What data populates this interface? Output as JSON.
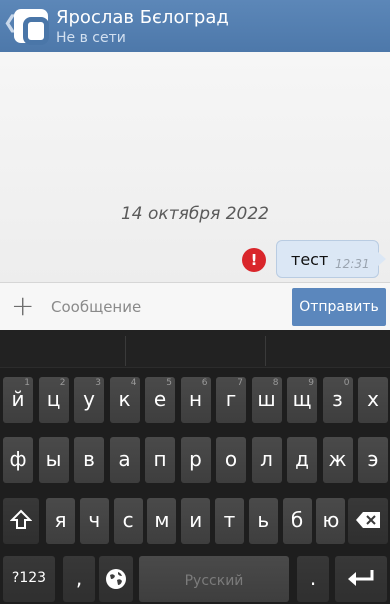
{
  "header": {
    "title": "Ярослав Бєлоград",
    "status": "Не в сети",
    "back_glyph": "❮"
  },
  "chat": {
    "date": "14 октября 2022",
    "message": {
      "text": "тест",
      "time": "12:31",
      "error_glyph": "!"
    }
  },
  "composer": {
    "placeholder": "Сообщение",
    "send_label": "Отправить",
    "attach_glyph": "+"
  },
  "keyboard": {
    "row1": [
      {
        "label": "й",
        "hint": "1"
      },
      {
        "label": "ц",
        "hint": "2"
      },
      {
        "label": "у",
        "hint": "3"
      },
      {
        "label": "к",
        "hint": "4"
      },
      {
        "label": "е",
        "hint": "5"
      },
      {
        "label": "н",
        "hint": "6"
      },
      {
        "label": "г",
        "hint": "7"
      },
      {
        "label": "ш",
        "hint": "8"
      },
      {
        "label": "щ",
        "hint": "9"
      },
      {
        "label": "з",
        "hint": "0"
      },
      {
        "label": "х",
        "hint": ""
      }
    ],
    "row2": [
      "ф",
      "ы",
      "в",
      "а",
      "п",
      "р",
      "о",
      "л",
      "д",
      "ж",
      "э"
    ],
    "row3": [
      "я",
      "ч",
      "с",
      "м",
      "и",
      "т",
      "ь",
      "б",
      "ю"
    ],
    "symbols_label": "?123",
    "comma_label": ",",
    "space_label": "Русский",
    "period_label": ".",
    "icons": [
      "shift-icon",
      "backspace-icon",
      "globe-icon",
      "enter-icon"
    ]
  },
  "colors": {
    "header": "#4d78aa",
    "send_button": "#5b87bd",
    "bubble": "#dbe7f5",
    "error": "#d9262b",
    "keyboard_bg": "#1e1e1e"
  }
}
